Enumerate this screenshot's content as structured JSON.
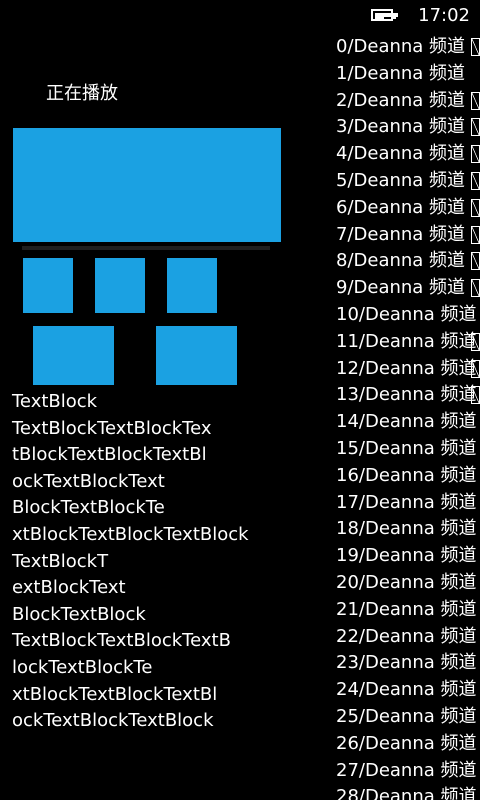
{
  "status_bar": {
    "time": "17:02"
  },
  "now_playing": {
    "title": "正在播放"
  },
  "text_blocks": [
    "TextBlock",
    "TextBlockTextBlockTex",
    "tBlockTextBlockTextBl",
    "ockTextBlockText",
    "BlockTextBlockTe",
    "xtBlockTextBlockTextBlock",
    "TextBlockT",
    "extBlockText",
    "BlockTextBlock",
    "TextBlockTextBlockTextB",
    "lockTextBlockTe",
    "xtBlockTextBlockTextBl",
    "ockTextBlockTextBlock"
  ],
  "channels": [
    "0/Deanna 频道",
    "1/Deanna 频道",
    "2/Deanna 频道",
    "3/Deanna 频道",
    "4/Deanna 频道",
    "5/Deanna 频道",
    "6/Deanna 频道",
    "7/Deanna 频道",
    "8/Deanna 频道",
    "9/Deanna 频道",
    "10/Deanna 频道",
    "11/Deanna 频道",
    "12/Deanna 频道",
    "13/Deanna 频道",
    "14/Deanna 频道",
    "15/Deanna 频道",
    "16/Deanna 频道",
    "17/Deanna 频道",
    "18/Deanna 频道",
    "19/Deanna 频道",
    "20/Deanna 频道",
    "21/Deanna 频道",
    "22/Deanna 频道",
    "23/Deanna 频道",
    "24/Deanna 频道",
    "25/Deanna 频道",
    "26/Deanna 频道",
    "27/Deanna 频道",
    "28/Deanna 频道"
  ],
  "colors": {
    "accent": "#1ba1e2",
    "background": "#000000",
    "text": "#ffffff"
  },
  "icons": {
    "battery": "battery-charging-icon"
  }
}
